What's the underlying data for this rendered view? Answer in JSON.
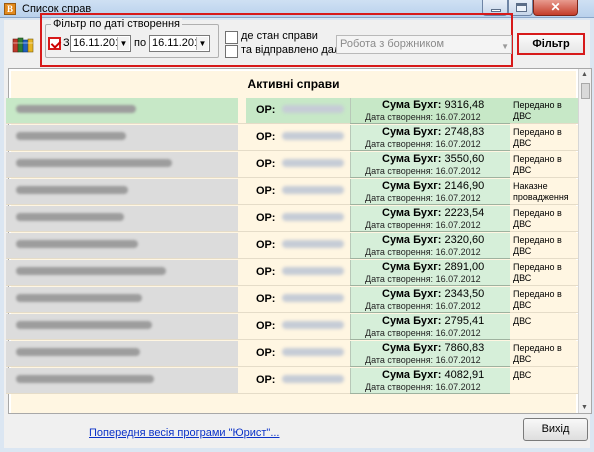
{
  "window": {
    "icon_letter": "B",
    "title": "Список справ",
    "close_glyph": "✕"
  },
  "toolbar": {
    "icon": "books-icon"
  },
  "filter": {
    "group_legend": "Фільтр по даті створення",
    "from_checked": true,
    "from_label": "З",
    "from_date": "16.11.2017",
    "to_label": "по",
    "to_date": "16.11.2017",
    "state_label": "де стан справи",
    "forwarded_label": "та відправлено далі",
    "state_select_value": "Робота з боржником",
    "filter_button": "Фільтр"
  },
  "list": {
    "title": "Активні справи",
    "op_label": "ОР:",
    "sum_label": "Сума Бухг:",
    "created_label": "Дата створення:",
    "rows": [
      {
        "sum": "9316,48",
        "created": "16.07.2012",
        "status": "Передано в ДВС"
      },
      {
        "sum": "2748,83",
        "created": "16.07.2012",
        "status": "Передано в ДВС"
      },
      {
        "sum": "3550,60",
        "created": "16.07.2012",
        "status": "Передано в ДВС"
      },
      {
        "sum": "2146,90",
        "created": "16.07.2012",
        "status": "Наказне провадження"
      },
      {
        "sum": "2223,54",
        "created": "16.07.2012",
        "status": "Передано в ДВС"
      },
      {
        "sum": "2320,60",
        "created": "16.07.2012",
        "status": "Передано в ДВС"
      },
      {
        "sum": "2891,00",
        "created": "16.07.2012",
        "status": "Передано в ДВС"
      },
      {
        "sum": "2343,50",
        "created": "16.07.2012",
        "status": "Передано в ДВС"
      },
      {
        "sum": "2795,41",
        "created": "16.07.2012",
        "status": "ДВС"
      },
      {
        "sum": "7860,83",
        "created": "16.07.2012",
        "status": "Передано в ДВС"
      },
      {
        "sum": "4082,91",
        "created": "16.07.2012",
        "status": "ДВС"
      }
    ]
  },
  "footer": {
    "link": "Попередня весія програми \"Юрист\"...",
    "exit_button": "Вихід"
  },
  "colors": {
    "accent_red": "#d71a1a",
    "row_highlight": "#c7e8c7",
    "sum_cell": "#d6efd9",
    "list_bg": "#fff6e2",
    "link": "#0b32c8"
  }
}
